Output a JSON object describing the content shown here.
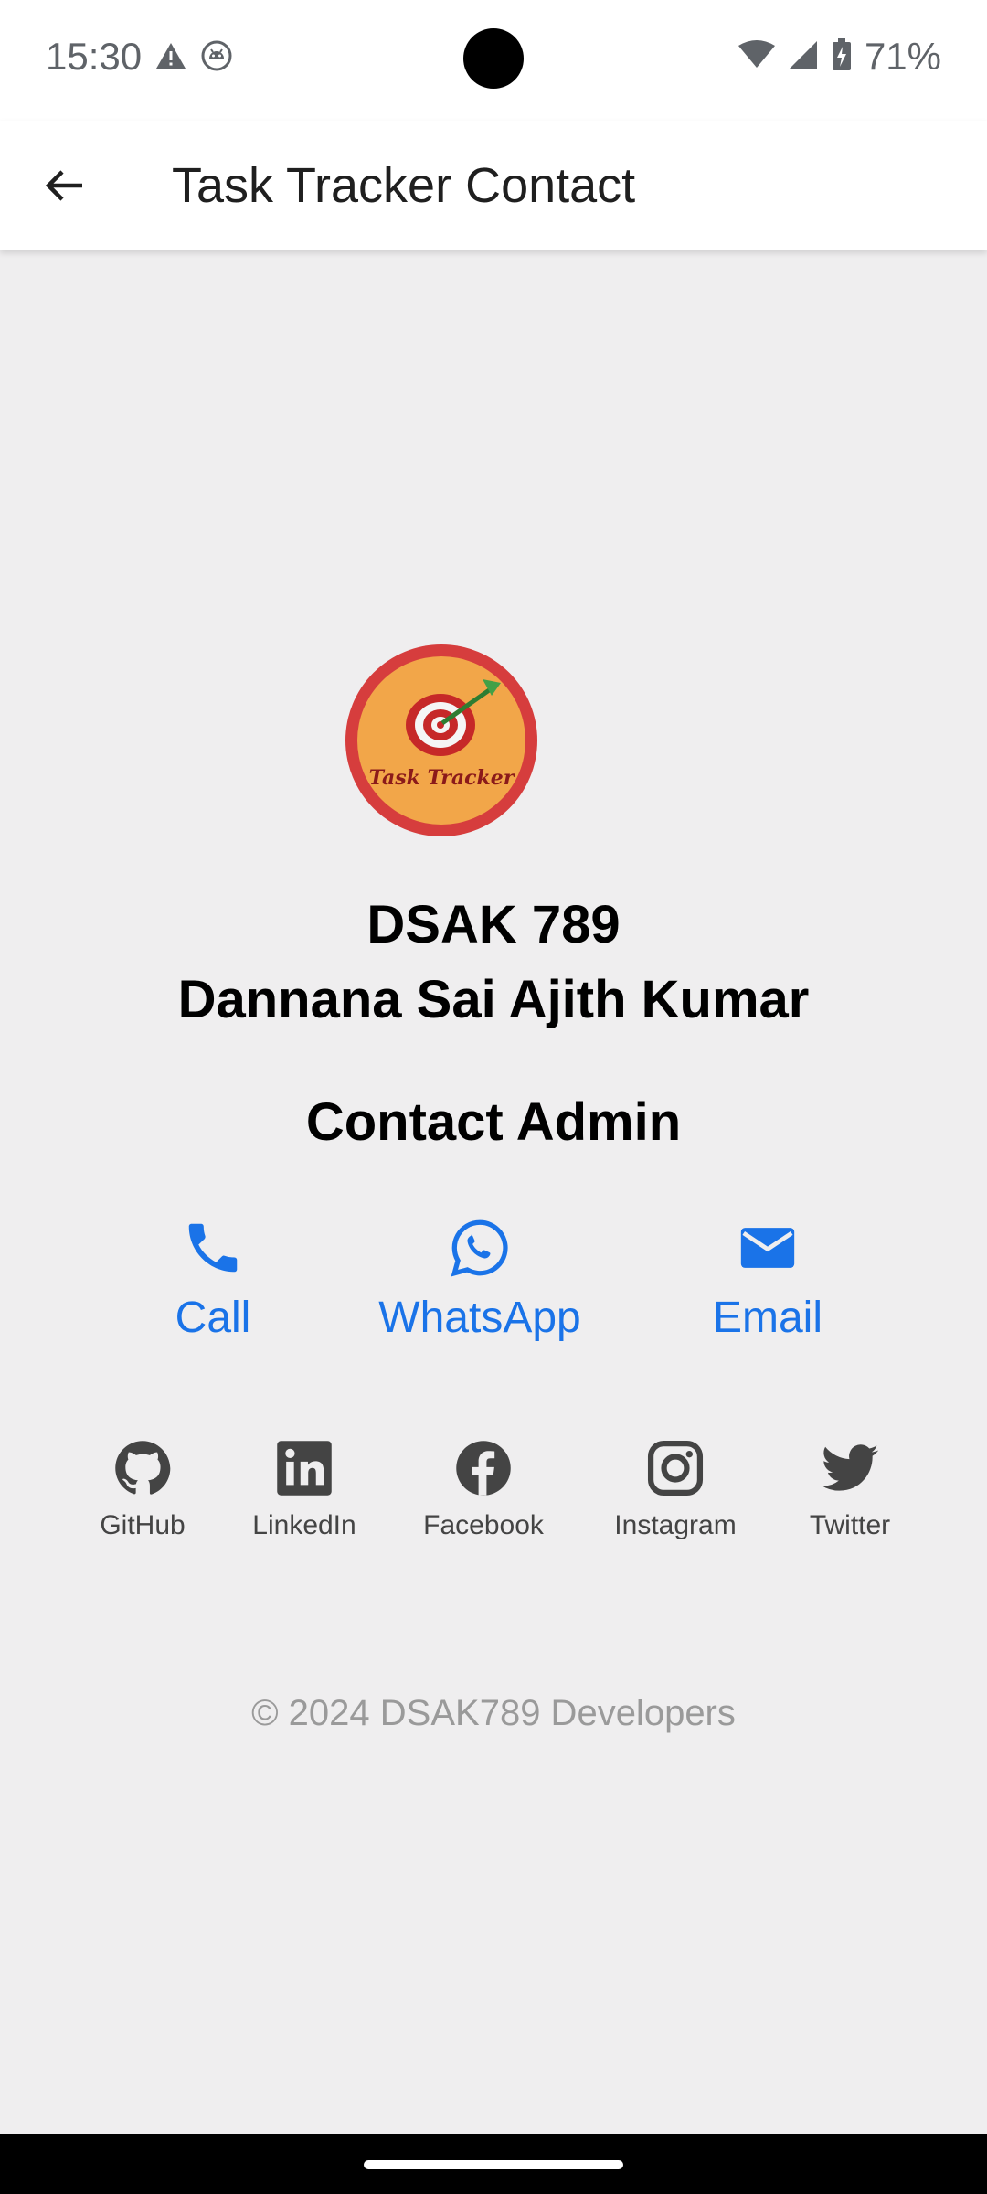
{
  "status_bar": {
    "time": "15:30",
    "battery": "71%",
    "icons": [
      "warning-icon",
      "android-icon",
      "wifi-icon",
      "signal-icon",
      "battery-charging-icon"
    ]
  },
  "app_bar": {
    "title": "Task Tracker Contact",
    "back_icon": "arrow-back-icon"
  },
  "logo": {
    "text": "Task Tracker",
    "colors": {
      "ring": "#d63d3d",
      "fill": "#f2a649",
      "target": "#c62828"
    }
  },
  "admin": {
    "handle": "DSAK 789",
    "name": "Dannana Sai Ajith Kumar"
  },
  "contact": {
    "heading": "Contact Admin",
    "actions": [
      {
        "label": "Call",
        "icon": "phone-icon"
      },
      {
        "label": "WhatsApp",
        "icon": "whatsapp-icon"
      },
      {
        "label": "Email",
        "icon": "email-icon"
      }
    ],
    "accent_color": "#1a73e8"
  },
  "social": [
    {
      "label": "GitHub",
      "icon": "github-icon"
    },
    {
      "label": "LinkedIn",
      "icon": "linkedin-icon"
    },
    {
      "label": "Facebook",
      "icon": "facebook-icon"
    },
    {
      "label": "Instagram",
      "icon": "instagram-icon"
    },
    {
      "label": "Twitter",
      "icon": "twitter-icon"
    }
  ],
  "footer": {
    "copyright": "© 2024 DSAK789 Developers"
  }
}
